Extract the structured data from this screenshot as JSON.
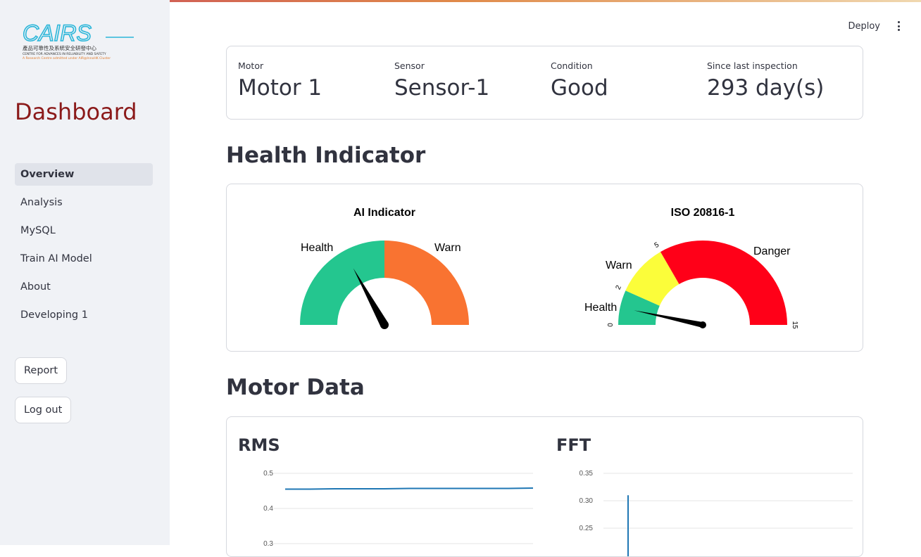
{
  "app": {
    "logo_text": "CAIRS",
    "logo_subtitle_cn": "產品可靠性及系統安全研發中心",
    "logo_subtitle_en": "CENTRE FOR ADVANCES IN RELIABILITY AND SAFETY",
    "logo_subtitle_2": "A Research Centre admitted under AIR@InnoHK Cluster"
  },
  "sidebar": {
    "title": "Dashboard",
    "items": [
      {
        "label": "Overview",
        "active": true
      },
      {
        "label": "Analysis",
        "active": false
      },
      {
        "label": "MySQL",
        "active": false
      },
      {
        "label": "Train AI Model",
        "active": false
      },
      {
        "label": "About",
        "active": false
      },
      {
        "label": "Developing 1",
        "active": false
      }
    ],
    "report_label": "Report",
    "logout_label": "Log out"
  },
  "header": {
    "deploy_label": "Deploy",
    "menu_icon": "kebab-menu-icon"
  },
  "metrics": [
    {
      "label": "Motor",
      "value": "Motor 1"
    },
    {
      "label": "Sensor",
      "value": "Sensor-1"
    },
    {
      "label": "Condition",
      "value": "Good"
    },
    {
      "label": "Since last inspection",
      "value": "293 day(s)"
    }
  ],
  "sections": {
    "health_title": "Health Indicator",
    "motor_title": "Motor Data"
  },
  "gauges": {
    "ai": {
      "title": "AI Indicator",
      "health_label": "Health",
      "warn_label": "Warn",
      "needle_fraction": 0.34,
      "colors": {
        "health": "#24c68f",
        "warn": "#f97331"
      }
    },
    "iso": {
      "title": "ISO 20816-1",
      "health_label": "Health",
      "warn_label": "Warn",
      "danger_label": "Danger",
      "ticks": [
        "0",
        "2",
        "5",
        "15"
      ],
      "tick_values": [
        0,
        2,
        5,
        15
      ],
      "max": 15,
      "value": 1.0,
      "colors": {
        "health": "#24c68f",
        "warn": "#fbfd3a",
        "danger": "#ff0018"
      }
    }
  },
  "charts": {
    "rms_title": "RMS",
    "fft_title": "FFT"
  },
  "chart_data": [
    {
      "type": "line",
      "title": "RMS",
      "y_ticks": [
        "0.5",
        "0.4",
        "0.3"
      ],
      "ylim": [
        0.3,
        0.5
      ],
      "series": [
        {
          "values": [
            0.455,
            0.455,
            0.456,
            0.456,
            0.456,
            0.457,
            0.457,
            0.457,
            0.457,
            0.457,
            0.458
          ]
        }
      ],
      "color": "#1f77b4"
    },
    {
      "type": "line",
      "title": "FFT",
      "y_ticks": [
        "0.35",
        "0.30",
        "0.25"
      ],
      "ylim": [
        0.2,
        0.35
      ],
      "series": [
        {
          "peak_value": 0.31
        }
      ],
      "color": "#1f77b4"
    }
  ]
}
